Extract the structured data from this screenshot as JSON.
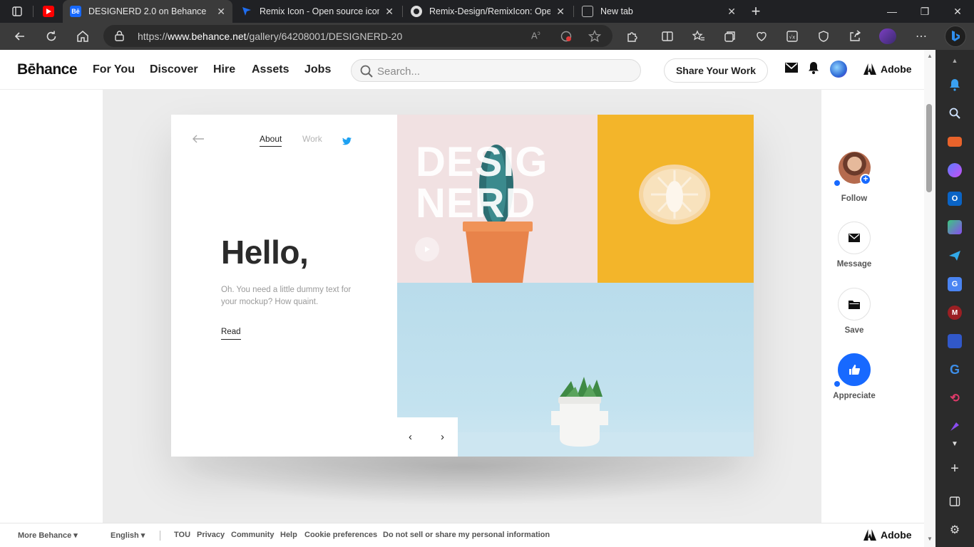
{
  "browser": {
    "tabs": [
      {
        "title": "",
        "favicon": "youtube-icon"
      },
      {
        "title": "DESIGNERD 2.0 on Behance",
        "favicon": "behance-icon",
        "active": true
      },
      {
        "title": "Remix Icon - Open source icon lib",
        "favicon": "remix-icon"
      },
      {
        "title": "Remix-Design/RemixIcon: Open s",
        "favicon": "github-icon"
      },
      {
        "title": "New tab",
        "favicon": "newtab-icon"
      }
    ],
    "url_prefix": "https://",
    "url_host": "www.behance.net",
    "url_path": "/gallery/64208001/DESIGNERD-20",
    "accent": "#1769ff"
  },
  "behance": {
    "logo": "Bēhance",
    "nav": [
      "For You",
      "Discover",
      "Hire",
      "Assets",
      "Jobs"
    ],
    "search_placeholder": "Search...",
    "share_label": "Share Your Work",
    "adobe_label": "Adobe"
  },
  "project": {
    "tab_about": "About",
    "tab_work": "Work",
    "hello": "Hello,",
    "dummy_text": "Oh. You need a little dummy text for your mockup? How quaint.",
    "read": "Read",
    "design_line1": "DESIG",
    "design_line2": "NERD",
    "prev": "‹",
    "next": "›"
  },
  "rail": {
    "follow": "Follow",
    "message": "Message",
    "save": "Save",
    "appreciate": "Appreciate"
  },
  "footer": {
    "more_behance": "More Behance ▾",
    "language": "English ▾",
    "links": [
      "TOU",
      "Privacy",
      "Community",
      "Help",
      "Cookie preferences",
      "Do not sell or share my personal information"
    ],
    "adobe": "Adobe"
  }
}
